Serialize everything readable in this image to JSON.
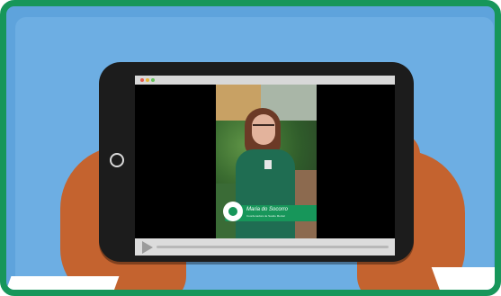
{
  "video": {
    "overlay": {
      "name": "Maria do Socorro",
      "role": "Coordenadora de Saúde Mental"
    },
    "browser_dots": [
      "red",
      "yellow",
      "green"
    ],
    "controls": {
      "play_icon": "play-icon"
    }
  },
  "colors": {
    "frame_border": "#17965a",
    "background_blue": "#5ea3dc",
    "hand_skin": "#c4632f",
    "tablet_body": "#1c1c1c",
    "nametag_green": "#17965a"
  }
}
